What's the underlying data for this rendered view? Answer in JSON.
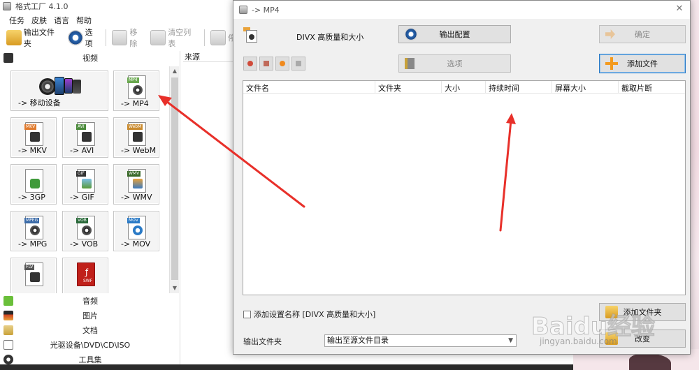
{
  "main_window": {
    "title": "格式工厂 4.1.0",
    "menu": [
      "任务",
      "皮肤",
      "语言",
      "帮助"
    ],
    "toolbar": {
      "output_folder": "输出文件夹",
      "options": "选项",
      "remove": "移除",
      "clear_list": "清空列表",
      "partial": "停"
    },
    "category_video": "视频",
    "tiles": {
      "mobile": "-> 移动设备",
      "mp4": "-> MP4",
      "mkv": "-> MKV",
      "avi": "-> AVI",
      "webm": "-> WebM",
      "gp3": "-> 3GP",
      "gif": "-> GIF",
      "wmv": "-> WMV",
      "mpg": "-> MPG",
      "vob": "-> VOB",
      "mov": "-> MOV"
    },
    "tile_tags": {
      "mp4": "MP4",
      "mkv": "MKV",
      "avi": "AVI",
      "webm": "WebM",
      "gif": "GIF",
      "wmv": "WMV",
      "mpg": "MPEG",
      "vob": "VOB",
      "mov": "MOV",
      "flv": "FLV",
      "swf": "SWF"
    },
    "categories": [
      "音频",
      "图片",
      "文档",
      "光驱设备\\DVD\\CD\\ISO",
      "工具集"
    ],
    "source_header": "来源"
  },
  "dialog": {
    "title": "-> MP4",
    "preset_text": "DIVX 高质量和大小",
    "output_config_button": "输出配置",
    "ok_button": "确定",
    "options_button": "选项",
    "add_file_button": "添加文件",
    "table_headers": [
      "文件名",
      "文件夹",
      "大小",
      "持续时间",
      "屏幕大小",
      "截取片断"
    ],
    "add_setting_checkbox": "添加设置名称 [DIVX 高质量和大小]",
    "add_folder_button": "添加文件夹",
    "output_folder_label": "输出文件夹",
    "output_folder_value": "输出至源文件目录",
    "change_button": "改变"
  },
  "watermark": {
    "main": "Baidu经验",
    "sub": "jingyan.baidu.com"
  },
  "colors": {
    "annotation_arrow": "#e8302a",
    "focus_border": "#2a7ac6",
    "add_icon": "#f39a1e"
  }
}
